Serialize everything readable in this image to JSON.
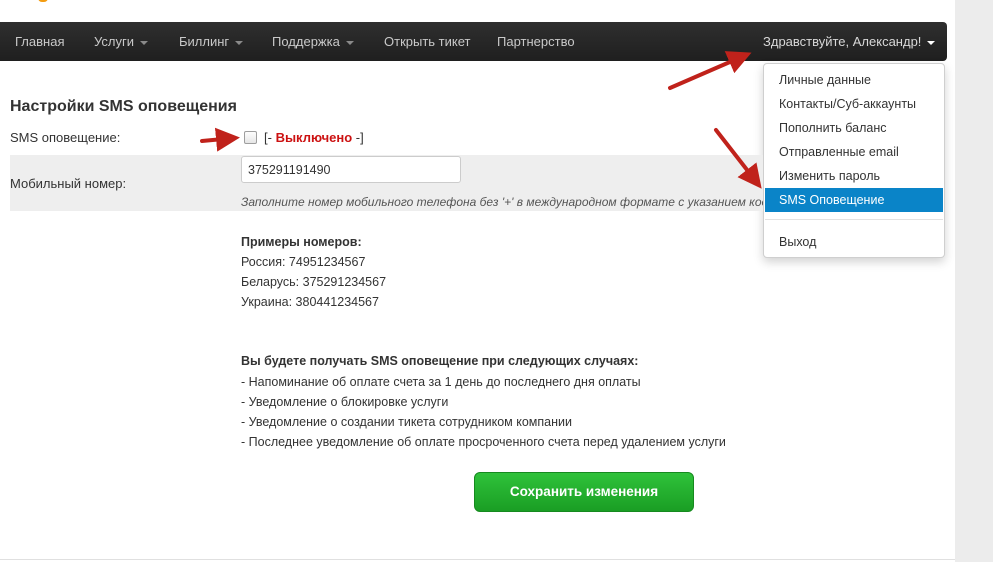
{
  "nav": {
    "items": [
      {
        "label": "Главная",
        "has_caret": false
      },
      {
        "label": "Услуги",
        "has_caret": true
      },
      {
        "label": "Биллинг",
        "has_caret": true
      },
      {
        "label": "Поддержка",
        "has_caret": true
      },
      {
        "label": "Открыть тикет",
        "has_caret": false
      },
      {
        "label": "Партнерство",
        "has_caret": false
      }
    ],
    "user_greeting": "Здравствуйте, Александр!"
  },
  "user_menu": {
    "items": [
      "Личные данные",
      "Контакты/Суб-аккаунты",
      "Пополнить баланс",
      "Отправленные email",
      "Изменить пароль",
      "SMS Оповещение"
    ],
    "active_item": "SMS Оповещение",
    "logout": "Выход"
  },
  "page": {
    "title": "Настройки SMS оповещения",
    "sms_label": "SMS оповещение:",
    "sms_enabled": false,
    "status_prefix": "[- ",
    "status_value": "Выключено",
    "status_suffix": " -]",
    "mobile_label": "Мобильный номер:",
    "phone_value": "375291191490",
    "hint": "Заполните номер мобильного телефона без '+' в международном формате с указанием кода страны",
    "examples_title": "Примеры номеров:",
    "examples": [
      "Россия: 74951234567",
      "Беларусь: 375291234567",
      "Украина: 380441234567"
    ],
    "notify_title": "Вы будете получать SMS оповещение при следующих случаях:",
    "notify_items": [
      "- Напоминание об оплате счета за 1 день до последнего дня оплаты",
      "- Уведомление о блокировке услуги",
      "- Уведомление о создании тикета сотрудником компании",
      "- Последнее уведомление об оплате просроченного счета перед удалением услуги"
    ],
    "save_label": "Сохранить изменения"
  },
  "colors": {
    "navbar": "#2a2a2a",
    "dropdown_active": "#0a84c8",
    "status_off": "#cc1111",
    "save_button": "#22b02d",
    "annotation_arrow": "#c0221b"
  }
}
